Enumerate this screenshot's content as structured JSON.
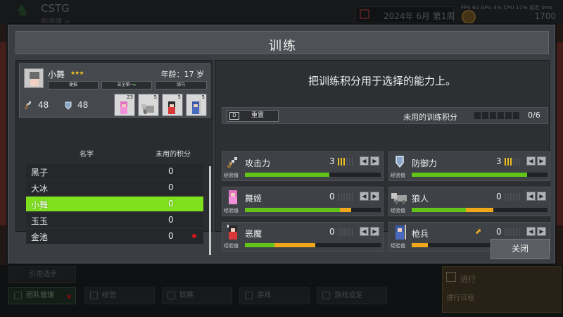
{
  "background": {
    "game_title": "CSTG",
    "game_subtitle": "明进球 >",
    "date": "2024年 6月 第1周",
    "perf_stats": "FPS 60   GPU 4%   CPU 11%   延迟 0ms",
    "money": "1700",
    "buttons": {
      "recruit": "引进选手",
      "team": "团队管理",
      "manage": "经营",
      "league": "联赛",
      "game": "游戏",
      "settings": "游戏设定"
    },
    "progress_title": "进行",
    "progress_sub": "进行日程"
  },
  "dialog": {
    "title": "训练",
    "close_label": "关闭"
  },
  "profile": {
    "name": "小舞",
    "stars": "★★★",
    "age": "年龄：17 岁",
    "tags": [
      "捷报",
      "安全第一",
      "骑马"
    ],
    "attack": "48",
    "defense": "48",
    "units": [
      {
        "icon": "dancer-unit-icon",
        "count": "23"
      },
      {
        "icon": "wolf-unit-icon",
        "count": "5"
      },
      {
        "icon": "demon-unit-icon",
        "count": "5"
      },
      {
        "icon": "spearman-unit-icon",
        "count": "5"
      }
    ]
  },
  "roster": {
    "col_name": "名字",
    "col_points": "未用的积分",
    "rows": [
      {
        "name": "黑子",
        "points": "0",
        "selected": false,
        "alert": false
      },
      {
        "name": "大冰",
        "points": "0",
        "selected": false,
        "alert": false
      },
      {
        "name": "小舞",
        "points": "0",
        "selected": true,
        "alert": false
      },
      {
        "name": "玉玉",
        "points": "0",
        "selected": false,
        "alert": false
      },
      {
        "name": "金池",
        "points": "0",
        "selected": false,
        "alert": true
      }
    ]
  },
  "training": {
    "instruction": "把训练积分用于选择的能力上。",
    "reset_key": "D",
    "reset_label": "重置",
    "unused_label": "未用的训练积分",
    "unused_count": "0/6",
    "exp_label": "经验值",
    "skills": [
      {
        "id": "atk",
        "name": "攻击力",
        "value": "3",
        "level_marks": 3,
        "exp_green": 0.62,
        "exp_orange": 0.0
      },
      {
        "id": "def",
        "name": "防御力",
        "value": "3",
        "level_marks": 3,
        "exp_green": 0.85,
        "exp_orange": 0.0
      },
      {
        "id": "dancer",
        "name": "舞姬",
        "value": "0",
        "level_marks": 0,
        "exp_green": 0.7,
        "exp_orange": 0.08
      },
      {
        "id": "wolf",
        "name": "狼人",
        "value": "0",
        "level_marks": 0,
        "exp_green": 0.4,
        "exp_orange": 0.2
      },
      {
        "id": "demon",
        "name": "恶魔",
        "value": "0",
        "level_marks": 0,
        "exp_green": 0.22,
        "exp_orange": 0.3
      },
      {
        "id": "spear",
        "name": "枪兵",
        "value": "0",
        "level_marks": 0,
        "exp_green": 0.0,
        "exp_orange": 0.12,
        "upgrade": true
      }
    ]
  },
  "colors": {
    "selected_row": "#7fe01e",
    "exp_green": "#62c418",
    "exp_orange": "#f0a81a",
    "star": "#f0c020",
    "alert": "#d01818"
  }
}
